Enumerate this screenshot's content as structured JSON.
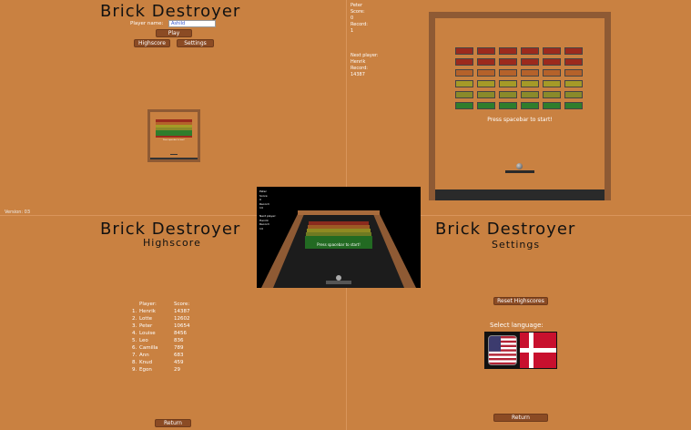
{
  "menu": {
    "title": "Brick Destroyer",
    "player_name_label": "Player name:",
    "player_name_value": "Ashild",
    "play_label": "Play",
    "highscore_label": "Highscore",
    "settings_label": "Settings",
    "preview_prompt": "Press spacebar to start!"
  },
  "game_hud": {
    "player_label": "Peter",
    "score_label": "Score:",
    "score_value": "0",
    "record_label": "Record:",
    "record_value": "1",
    "next_player_label": "Next player:",
    "next_player_value": "Henrik",
    "next_record_label": "Record:",
    "next_record_value": "14387",
    "prompt": "Press spacebar to start!"
  },
  "version": "Version: 03",
  "highscore": {
    "title": "Brick Destroyer",
    "subtitle": "Highscore",
    "col_player": "Player:",
    "col_score": "Score:",
    "rows": [
      {
        "rank": "1.",
        "name": "Henrik",
        "score": "14387"
      },
      {
        "rank": "2.",
        "name": "Lotte",
        "score": "12602"
      },
      {
        "rank": "3.",
        "name": "Peter",
        "score": "10654"
      },
      {
        "rank": "4.",
        "name": "Louise",
        "score": "8456"
      },
      {
        "rank": "5.",
        "name": "Leo",
        "score": "836"
      },
      {
        "rank": "6.",
        "name": "Camilla",
        "score": "789"
      },
      {
        "rank": "7.",
        "name": "Ann",
        "score": "683"
      },
      {
        "rank": "8.",
        "name": "Knud",
        "score": "459"
      },
      {
        "rank": "9.",
        "name": "Egon",
        "score": "29"
      }
    ],
    "return_label": "Return"
  },
  "settings": {
    "title": "Brick Destroyer",
    "subtitle": "Settings",
    "reset_label": "Reset Highscores",
    "language_label": "Select language:",
    "return_label": "Return"
  },
  "view3d": {
    "hud_lines": [
      "Peter",
      "Score:",
      "0",
      "Record:",
      "14",
      "",
      "Next player:",
      "Henrik",
      "Record:",
      "14"
    ],
    "prompt": "Press spacebar to start!"
  },
  "colors": {
    "background": "#c98141",
    "frame": "#8e5a34",
    "button": "#8b4b24"
  }
}
